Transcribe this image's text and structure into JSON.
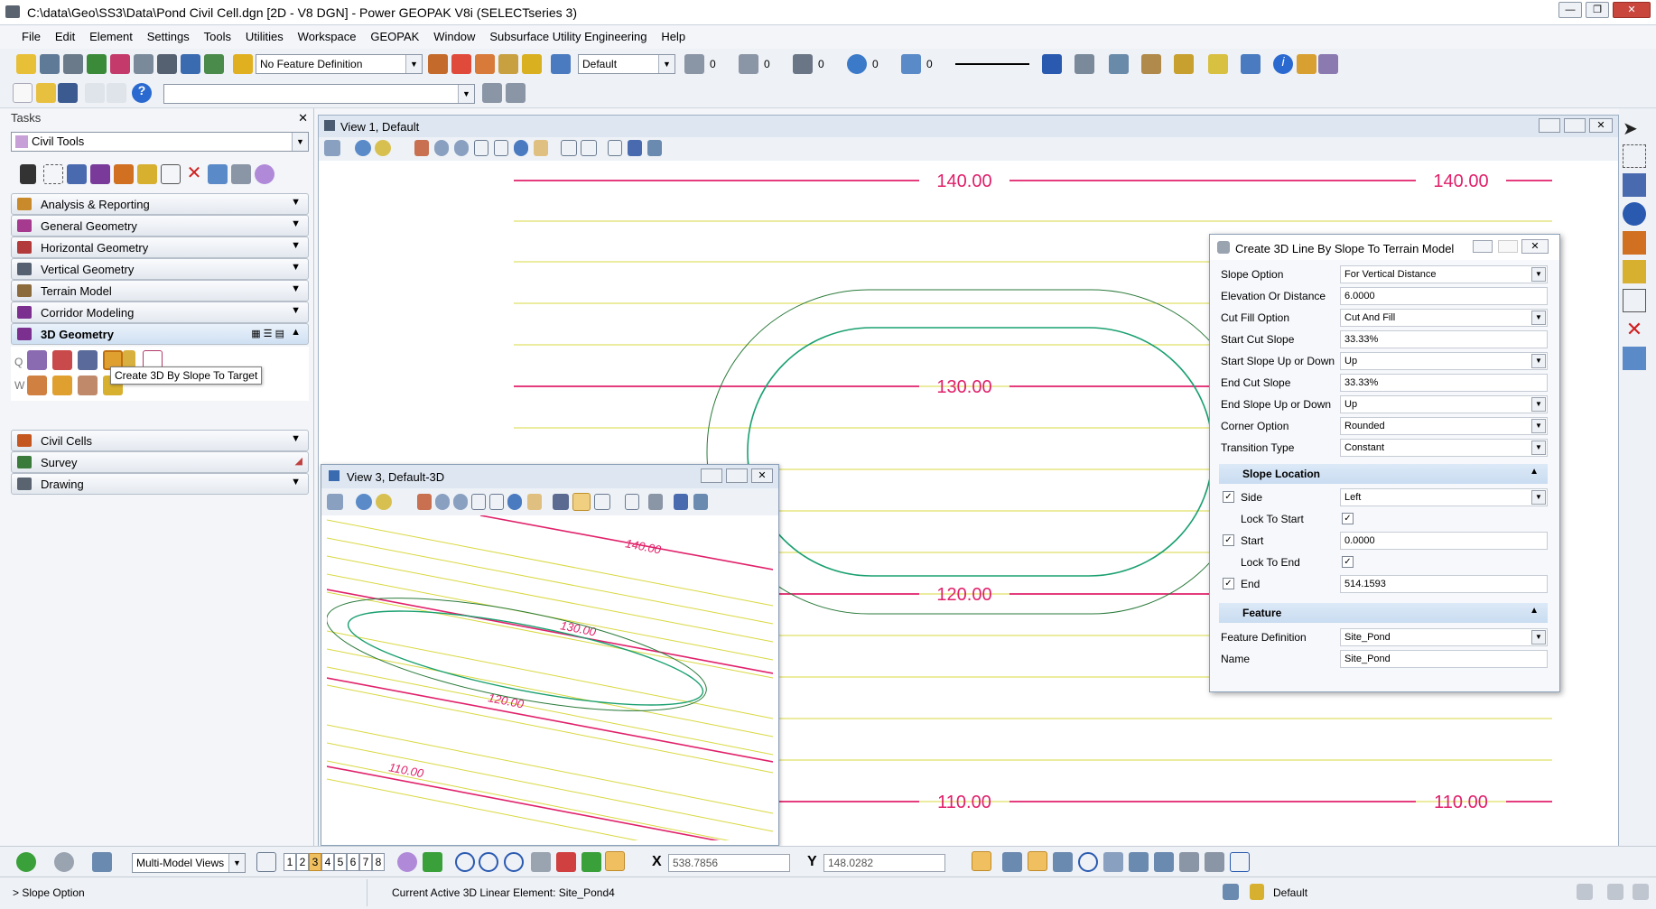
{
  "app": {
    "title": "C:\\data\\Geo\\SS3\\Data\\Pond Civil Cell.dgn [2D - V8 DGN] - Power GEOPAK V8i (SELECTseries 3)",
    "window_buttons": [
      "—",
      "❐",
      "✕"
    ]
  },
  "menu": [
    "File",
    "Edit",
    "Element",
    "Settings",
    "Tools",
    "Utilities",
    "Workspace",
    "GEOPAK",
    "Window",
    "Subsurface Utility Engineering",
    "Help"
  ],
  "toolbar": {
    "feature_definition": "No Feature Definition",
    "level": "Default",
    "counts": [
      "0",
      "0",
      "0",
      "0",
      "0"
    ],
    "key_in": ""
  },
  "tasks": {
    "header": "Tasks",
    "selector": "Civil Tools",
    "sections": [
      {
        "label": "Analysis & Reporting",
        "color": "#c98a2c"
      },
      {
        "label": "General Geometry",
        "color": "#a63a8e"
      },
      {
        "label": "Horizontal Geometry",
        "color": "#b33a3a"
      },
      {
        "label": "Vertical Geometry",
        "color": "#556070"
      },
      {
        "label": "Terrain Model",
        "color": "#8b6a3b"
      },
      {
        "label": "Corridor Modeling",
        "color": "#7b2f8f"
      }
    ],
    "active_section": "3D Geometry",
    "tooltip": "Create 3D By Slope To Target",
    "row_letters": [
      "Q",
      "W"
    ],
    "lower_sections": [
      {
        "label": "Civil Cells",
        "color": "#c4571f"
      },
      {
        "label": "Survey",
        "color": "#3a7a3a"
      },
      {
        "label": "Drawing",
        "color": "#5a6470"
      }
    ]
  },
  "view1": {
    "title": "View 1, Default",
    "contours": [
      {
        "label": "140.00",
        "labels": 2
      },
      {
        "label": "130.00",
        "labels": 1
      },
      {
        "label": "120.00",
        "labels": 1
      },
      {
        "label": "110.00",
        "labels": 2
      }
    ]
  },
  "view3": {
    "title": "View 3, Default-3D",
    "labels": [
      "140.00",
      "130.00",
      "120.00",
      "110.00"
    ]
  },
  "dialog": {
    "title": "Create 3D Line By Slope To Terrain Model",
    "fields": [
      {
        "label": "Slope Option",
        "value": "For Vertical Distance",
        "dropdown": true
      },
      {
        "label": "Elevation Or Distance",
        "value": "6.0000",
        "dropdown": false
      },
      {
        "label": "Cut Fill Option",
        "value": "Cut And Fill",
        "dropdown": true
      },
      {
        "label": "Start Cut Slope",
        "value": "33.33%",
        "dropdown": false
      },
      {
        "label": "Start Slope Up or Down",
        "value": "Up",
        "dropdown": true
      },
      {
        "label": "End Cut Slope",
        "value": "33.33%",
        "dropdown": false
      },
      {
        "label": "End Slope Up or Down",
        "value": "Up",
        "dropdown": true
      },
      {
        "label": "Corner Option",
        "value": "Rounded",
        "dropdown": true
      },
      {
        "label": "Transition Type",
        "value": "Constant",
        "dropdown": true
      }
    ],
    "slope_location": {
      "header": "Slope Location",
      "side_label": "Side",
      "side_value": "Left",
      "lock_start_label": "Lock To Start",
      "start_label": "Start",
      "start_value": "0.0000",
      "lock_end_label": "Lock To End",
      "end_label": "End",
      "end_value": "514.1593"
    },
    "feature": {
      "header": "Feature",
      "def_label": "Feature Definition",
      "def_value": "Site_Pond",
      "name_label": "Name",
      "name_value": "Site_Pond"
    }
  },
  "status": {
    "view_mode": "Multi-Model Views",
    "view_numbers": [
      "1",
      "2",
      "3",
      "4",
      "5",
      "6",
      "7",
      "8"
    ],
    "active_view": "3",
    "x_label": "X",
    "x_value": "538.7856",
    "y_label": "Y",
    "y_value": "148.0282",
    "prompt": "> Slope Option",
    "message": "Current Active 3D Linear Element: Site_Pond4",
    "level": "Default"
  },
  "colors": {
    "contour_major": "#e0206a",
    "contour_minor": "#d8d840",
    "pond": "#1aa070",
    "pond_dark": "#2a7a3a"
  }
}
